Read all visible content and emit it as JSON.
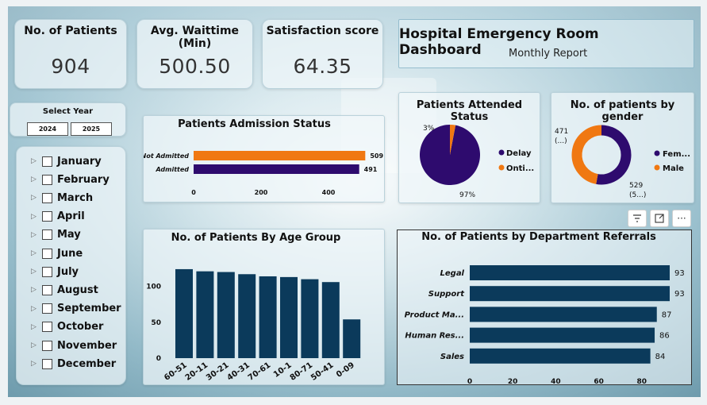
{
  "kpis": [
    {
      "title": "No. of Patients",
      "value": "904"
    },
    {
      "title": "Avg. Waittime (Min)",
      "value": "500.50"
    },
    {
      "title": "Satisfaction score",
      "value": "64.35"
    }
  ],
  "header": {
    "title": "Hospital Emergency Room Dashboard",
    "subtitle": "Monthly Report"
  },
  "year_slicer": {
    "title": "Select Year",
    "options": [
      "2024",
      "2025"
    ]
  },
  "months": [
    "January",
    "February",
    "March",
    "April",
    "May",
    "June",
    "July",
    "August",
    "September",
    "October",
    "November",
    "December"
  ],
  "colors": {
    "navy": "#0b3a5b",
    "purple": "#2e0b6e",
    "orange": "#f07812"
  },
  "chart_data": [
    {
      "type": "bar",
      "orientation": "horizontal",
      "title": "Patients Admission Status",
      "categories": [
        "Not Admitted",
        "Admitted"
      ],
      "values": [
        509,
        491
      ],
      "xticks": [
        0,
        200,
        400
      ],
      "xlim": [
        0,
        520
      ],
      "colors": [
        "#f07812",
        "#2e0b6e"
      ]
    },
    {
      "type": "pie",
      "title": "Patients Attended Status",
      "legend": [
        "Delay",
        "Onti..."
      ],
      "values": [
        97,
        3
      ],
      "labels": [
        "97%",
        "3%"
      ],
      "colors": [
        "#2e0b6e",
        "#f07812"
      ],
      "legend_position": "right"
    },
    {
      "type": "pie",
      "variant": "donut",
      "title": "No. of patients by gender",
      "legend": [
        "Fem...",
        "Male"
      ],
      "values": [
        529,
        471
      ],
      "labels": [
        [
          "529",
          "(5...)"
        ],
        [
          "471",
          "(...)"
        ]
      ],
      "colors": [
        "#2e0b6e",
        "#f07812"
      ],
      "legend_position": "right"
    },
    {
      "type": "bar",
      "title": "No. of Patients By Age Group",
      "categories": [
        "60-51",
        "20-11",
        "30-21",
        "40-31",
        "70-61",
        "10-1",
        "80-71",
        "50-41",
        "0-09"
      ],
      "values": [
        124,
        121,
        120,
        117,
        114,
        113,
        110,
        106,
        54
      ],
      "yticks": [
        0,
        50,
        100
      ],
      "ylim": [
        0,
        135
      ],
      "color": "#0b3a5b"
    },
    {
      "type": "bar",
      "orientation": "horizontal",
      "title": "No. of Patients by Department Referrals",
      "categories": [
        "Legal",
        "Support",
        "Product Ma...",
        "Human Res...",
        "Sales"
      ],
      "values": [
        93,
        93,
        87,
        86,
        84
      ],
      "xticks": [
        0,
        20,
        40,
        60,
        80
      ],
      "xlim": [
        0,
        93
      ],
      "color": "#0b3a5b"
    }
  ]
}
